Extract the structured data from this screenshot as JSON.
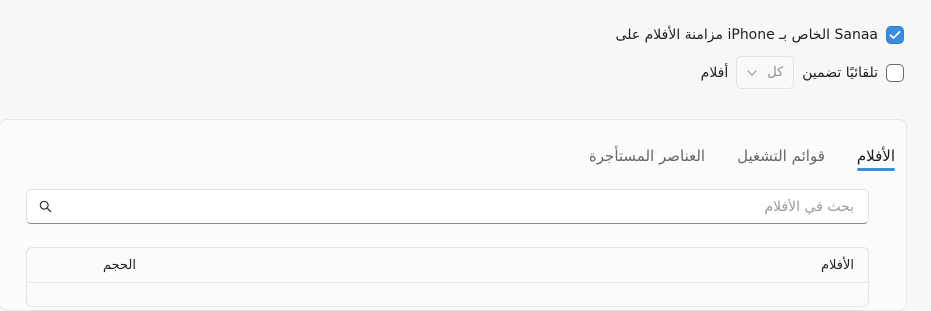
{
  "sync": {
    "label": "مزامنة الأفلام على iPhone الخاص بـ Sanaa",
    "checked": true
  },
  "auto_include": {
    "label_before": "تلقائيًا تضمين",
    "dropdown_value": "كل",
    "label_after": "أفلام",
    "checked": false
  },
  "tabs": [
    {
      "label": "الأفلام",
      "active": true
    },
    {
      "label": "قوائم التشغيل",
      "active": false
    },
    {
      "label": "العناصر المستأجرة",
      "active": false
    }
  ],
  "search": {
    "placeholder": "بحث في الأفلام",
    "value": ""
  },
  "table": {
    "columns": {
      "films": "الأفلام",
      "size": "الحجم"
    }
  },
  "colors": {
    "accent": "#3a8dde"
  },
  "icons": {
    "check": "check-icon",
    "chevron": "chevron-down-icon",
    "search": "search-icon"
  }
}
